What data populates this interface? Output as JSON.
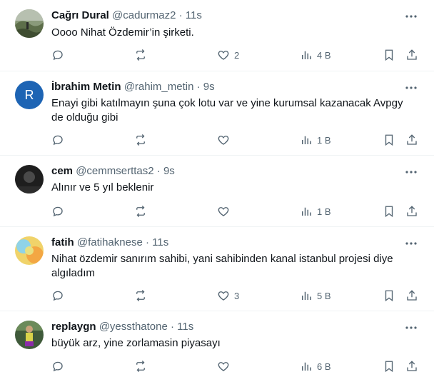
{
  "colors": {
    "text": "#0f1419",
    "secondary": "#536471",
    "divider": "#eff3f4",
    "avatar_r": "#1d64b4"
  },
  "dot": "·",
  "tweets": [
    {
      "name": "Cağrı Dural",
      "handle": "@cadurmaz2",
      "time": "11s",
      "text": "Oooo Nihat Özdemir’in şirketi.",
      "replies": "",
      "retweets": "",
      "likes": "2",
      "views": "4 B",
      "avatar_icon": "landscape-photo-avatar"
    },
    {
      "name": "İbrahim Metin",
      "handle": "@rahim_metin",
      "time": "9s",
      "text": "Enayi gibi katılmayın şuna çok lotu var ve yine kurumsal kazanacak Avpgy de olduğu gibi",
      "replies": "",
      "retweets": "",
      "likes": "",
      "views": "1 B",
      "avatar_letter": "R"
    },
    {
      "name": "cem",
      "handle": "@cemmserttas2",
      "time": "9s",
      "text": "Alınır ve 5 yıl beklenir",
      "replies": "",
      "retweets": "",
      "likes": "",
      "views": "1 B",
      "avatar_icon": "dark-photo-avatar"
    },
    {
      "name": "fatih",
      "handle": "@fatihaknese",
      "time": "11s",
      "text": "Nihat özdemir sanırım sahibi, yani sahibinden kanal istanbul projesi diye algıladım",
      "replies": "",
      "retweets": "",
      "likes": "3",
      "views": "5 B",
      "avatar_icon": "colorful-photo-avatar"
    },
    {
      "name": "replaygn",
      "handle": "@yessthatone",
      "time": "11s",
      "text": "büyük arz, yine zorlamasin piyasayı",
      "replies": "",
      "retweets": "",
      "likes": "",
      "views": "6 B",
      "avatar_icon": "person-photo-avatar"
    }
  ]
}
